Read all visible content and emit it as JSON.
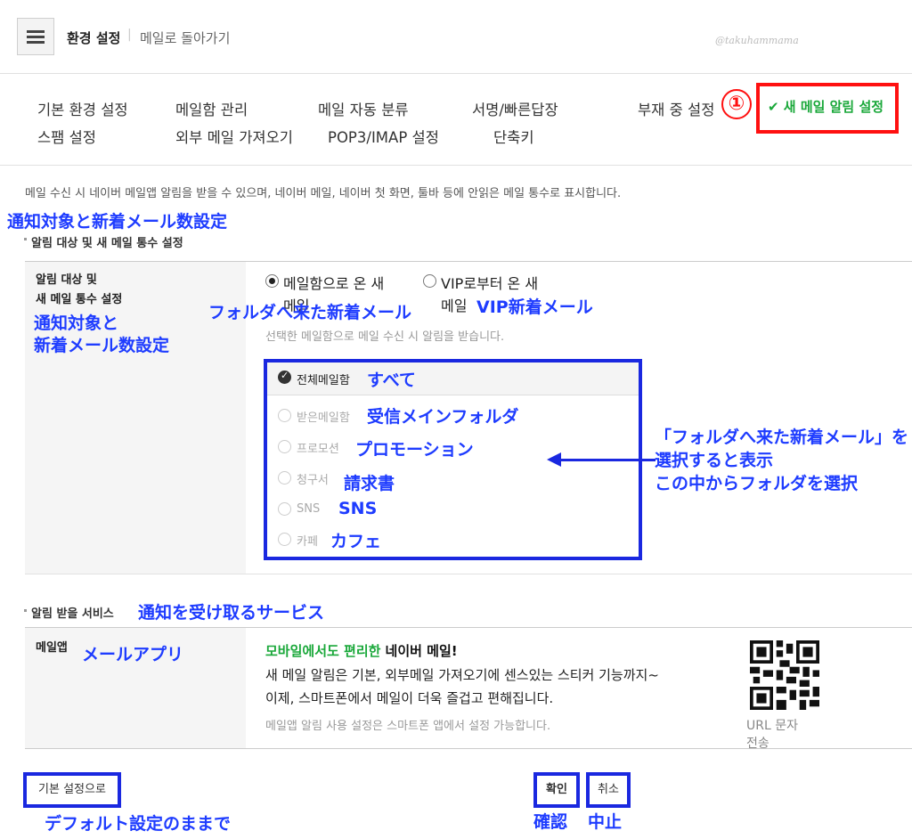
{
  "header": {
    "title": "환경 설정",
    "separator": "|",
    "back_link": "메일로 돌아가기",
    "watermark": "@takuhammama"
  },
  "tabs": {
    "row1": [
      "기본 환경 설정",
      "메일함 관리",
      "메일 자동 분류",
      "서명/빠른답장",
      "부재 중 설정"
    ],
    "row2": [
      "스팸 설정",
      "외부 메일 가져오기",
      "POP3/IMAP 설정",
      "단축키"
    ],
    "active": "✔ 새 메일 알림 설정",
    "annotation_number": "①"
  },
  "description": "메일 수신 시 네이버 메일앱 알림을 받을 수 있으며, 네이버 메일, 네이버 첫 화면, 툴바 등에 안읽은 메일 통수로 표시합니다.",
  "section1": {
    "annotation": "通知対象と新着メール数設定",
    "title": "알림 대상 및 새 메일 통수 설정",
    "label_line1": "알림 대상 및",
    "label_line2": "새 메일 통수 설정",
    "label_annotation_line1": "通知対象と",
    "label_annotation_line2": "新着メール数設定",
    "radio1_line1": "메일함으로 온 새",
    "radio1_line2": "메일",
    "radio1_annotation": "フォルダへ来た新着メール",
    "radio2_line1": "VIP로부터 온 새",
    "radio2_line2": "메일",
    "radio2_annotation": "VIP新着メール",
    "hint": "선택한 메일함으로 메일 수신 시 알림을 받습니다.",
    "folders": [
      {
        "label": "전체메일함",
        "annotation": "すべて",
        "checked": true
      },
      {
        "label": "받은메일함",
        "annotation": "受信メインフォルダ",
        "checked": false
      },
      {
        "label": "프로모션",
        "annotation": "プロモーション",
        "checked": false
      },
      {
        "label": "청구서",
        "annotation": "請求書",
        "checked": false
      },
      {
        "label": "SNS",
        "annotation": "SNS",
        "checked": false
      },
      {
        "label": "카페",
        "annotation": "カフェ",
        "checked": false
      }
    ],
    "arrow_note_line1": "「フォルダへ来た新着メール」を",
    "arrow_note_line2": "選択すると表示",
    "arrow_note_line3": "この中からフォルダを選択"
  },
  "section2": {
    "title": "알림 받을 서비스",
    "annotation": "通知を受け取るサービス",
    "label": "메일앱",
    "label_annotation": "メールアプリ",
    "promo_green": "모바일에서도 편리한",
    "promo_black": "네이버 메일!",
    "body_line1": "새 메일 알림은 기본, 외부메일 가져오기에 센스있는 스티커 기능까지~",
    "body_line2": "이제, 스마트폰에서 메일이 더욱 즐겁고 편해집니다.",
    "hint": "메일앱 알림 사용 설정은 스마트폰 앱에서 설정 가능합니다.",
    "qr_caption_line1": "URL 문자",
    "qr_caption_line2": "전송"
  },
  "footer": {
    "default_button": "기본 설정으로",
    "default_annotation": "デフォルト設定のままで",
    "confirm_button": "확인",
    "confirm_annotation": "確認",
    "cancel_button": "취소",
    "cancel_annotation": "中止"
  },
  "colors": {
    "annotation_blue": "#1a28e0",
    "active_green": "#1aa83a",
    "highlight_red": "#ff1010"
  }
}
